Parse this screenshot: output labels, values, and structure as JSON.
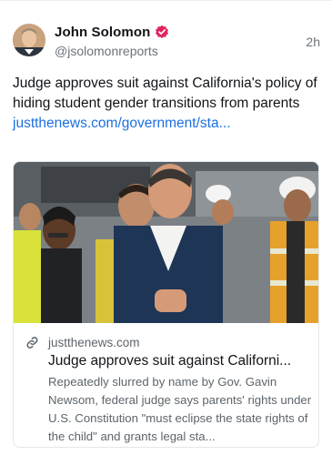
{
  "author": {
    "display_name": "John Solomon",
    "handle": "@jsolomonreports",
    "verified_icon": "verified-badge-icon",
    "verified_color": "#e0245e"
  },
  "post": {
    "timestamp": "2h",
    "text": "Judge approves suit against California's policy of hiding student gender transitions from parents ",
    "link_text": "justthenews.com/government/sta..."
  },
  "link_card": {
    "domain": "justthenews.com",
    "title": "Judge approves suit against Californi...",
    "description": "Repeatedly slurred by name by Gov. Gavin Newsom, federal judge says parents' rights under U.S. Constitution \"must eclipse the state rights of the child\" and grants legal sta...",
    "image_alt": "photo-of-people-at-event"
  },
  "colors": {
    "link": "#1d6fe0",
    "text": "#111418",
    "muted": "#6b7278"
  }
}
